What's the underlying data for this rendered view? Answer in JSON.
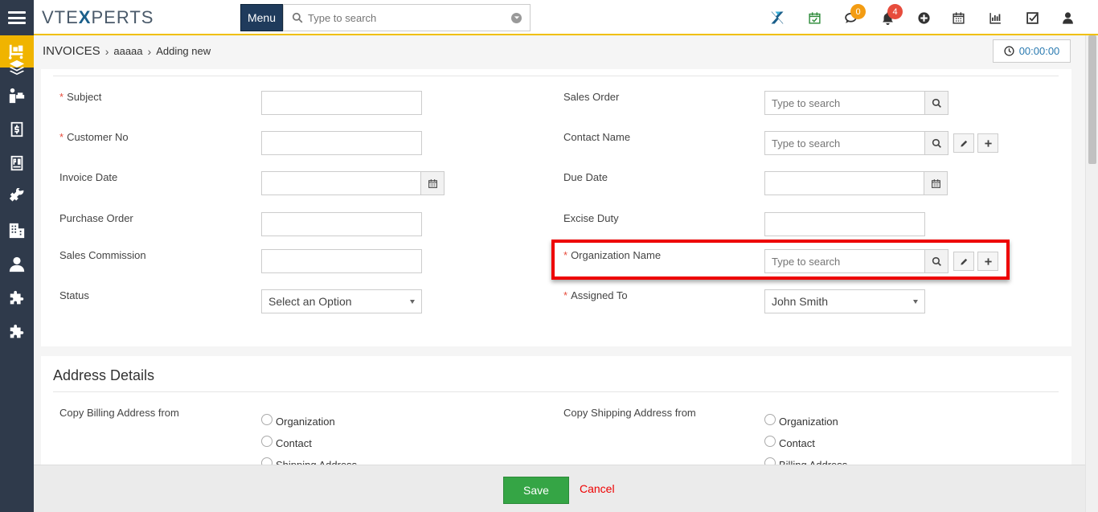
{
  "header": {
    "logo_left": "VTE",
    "logo_x": "X",
    "logo_right": "PERTS",
    "menu_label": "Menu",
    "search_placeholder": "Type to search",
    "chat_badge": "0",
    "notification_badge": "4"
  },
  "sidebar": {
    "items": [
      {
        "icon": "inventory-icon"
      },
      {
        "icon": "products-icon"
      },
      {
        "icon": "services-icon"
      },
      {
        "icon": "invoice-icon"
      },
      {
        "icon": "purchase-order-icon"
      },
      {
        "icon": "tools-icon"
      },
      {
        "icon": "organizations-icon"
      },
      {
        "icon": "contacts-icon"
      },
      {
        "icon": "extension-icon"
      },
      {
        "icon": "extension-icon"
      }
    ]
  },
  "breadcrumb": {
    "module": "Invoices",
    "record": "aaaaa",
    "action": "Adding new"
  },
  "timer": "00:00:00",
  "form": {
    "subject_label": "Subject",
    "customer_no_label": "Customer No",
    "invoice_date_label": "Invoice Date",
    "purchase_order_label": "Purchase Order",
    "sales_commission_label": "Sales Commission",
    "status_label": "Status",
    "status_value": "Select an Option",
    "sales_order_label": "Sales Order",
    "contact_name_label": "Contact Name",
    "due_date_label": "Due Date",
    "excise_duty_label": "Excise Duty",
    "organization_name_label": "Organization Name",
    "assigned_to_label": "Assigned To",
    "assigned_to_value": "John Smith",
    "search_placeholder": "Type to search",
    "required_mark": "*"
  },
  "address": {
    "title": "Address Details",
    "billing_label": "Copy Billing Address from",
    "shipping_label": "Copy Shipping Address from",
    "billing_options": [
      "Organization",
      "Contact",
      "Shipping Address"
    ],
    "shipping_options": [
      "Organization",
      "Contact",
      "Billing Address"
    ]
  },
  "footer": {
    "save_label": "Save",
    "cancel_label": "Cancel"
  },
  "colors": {
    "sidebar_bg": "#2f3a4b",
    "sidebar_active": "#f0b400",
    "menu_button": "#1f3b5c",
    "save_green": "#35a545",
    "cancel_red": "#e00000",
    "highlight_red": "#e00000",
    "chat_badge": "#f39c12",
    "notification_badge": "#e74c3c"
  }
}
